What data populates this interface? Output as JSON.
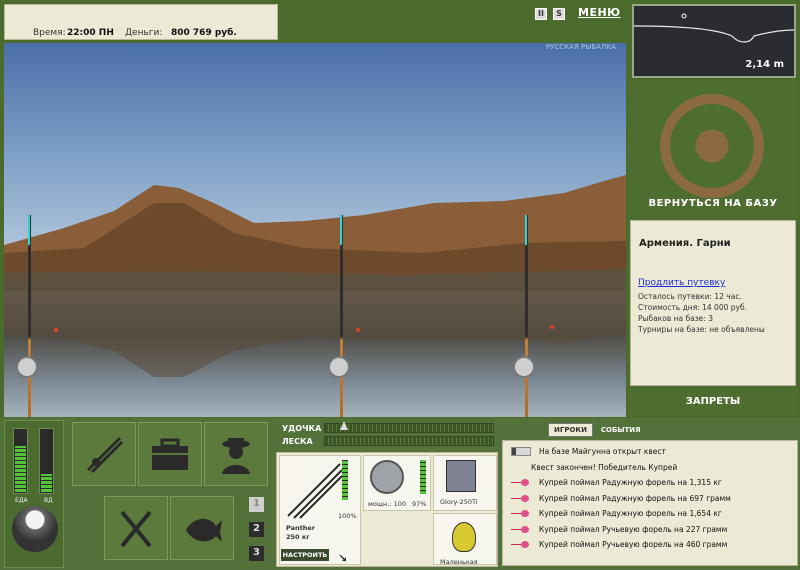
{
  "status": {
    "time_label": "Время:",
    "time_value": "22:00 ПН",
    "money_label": "Деньги:",
    "money_value": "800 769 руб."
  },
  "top_icons": {
    "pause": "II",
    "sound": "S",
    "menu": "МЕНЮ"
  },
  "depth": {
    "value": "2,14 m"
  },
  "scene": {
    "watermark": "РУССКАЯ РЫБАЛКА"
  },
  "base": {
    "return_label": "ВЕРНУТЬСЯ НА БАЗУ",
    "location": "Армения. Гарни",
    "extend_link": "Продлить путевку",
    "lines": [
      "Осталось путевки: 12 час.",
      "Стоимость дня: 14 000 руб.",
      "Рыбаков на базе: 3",
      "Турниры на базе: не объявлены"
    ],
    "bans_label": "ЗАПРЕТЫ"
  },
  "food": {
    "food_label": "ЕДА",
    "drink_label": "ВД",
    "food_level": 0.72,
    "drink_level": 0.28
  },
  "pages": [
    "1",
    "2",
    "3"
  ],
  "tackle": {
    "rod_label": "УДОЧКА",
    "line_label": "ЛЕСКА",
    "rod_name": "Panther",
    "rod_weight": "250 кг",
    "rod_percent": "100%",
    "reel_power": "мощн.: 100",
    "reel_percent": "97%",
    "line_name": "Glory-250Ti",
    "lure_name": "Маленькая",
    "setup_label": "НАСТРОИТЬ"
  },
  "events": {
    "tabs": [
      "ИГРОКИ",
      "СОБЫТИЯ"
    ],
    "items": [
      {
        "icon": "flag",
        "text": "На базе Майгунна открыт квест"
      },
      {
        "icon": "none",
        "text": "Квест закончен! Победитель Купрей"
      },
      {
        "icon": "lure",
        "text": "Купрей поймал Радужную форель на 1,315 кг"
      },
      {
        "icon": "lure",
        "text": "Купрей поймал Радужную форель на 697 грамм"
      },
      {
        "icon": "lure",
        "text": "Купрей поймал Радужную форель на 1,654 кг"
      },
      {
        "icon": "lure",
        "text": "Купрей поймал Ручьевую форель на 227 грамм"
      },
      {
        "icon": "lure",
        "text": "Купрей поймал Ручьевую форель на 460 грамм"
      }
    ]
  }
}
